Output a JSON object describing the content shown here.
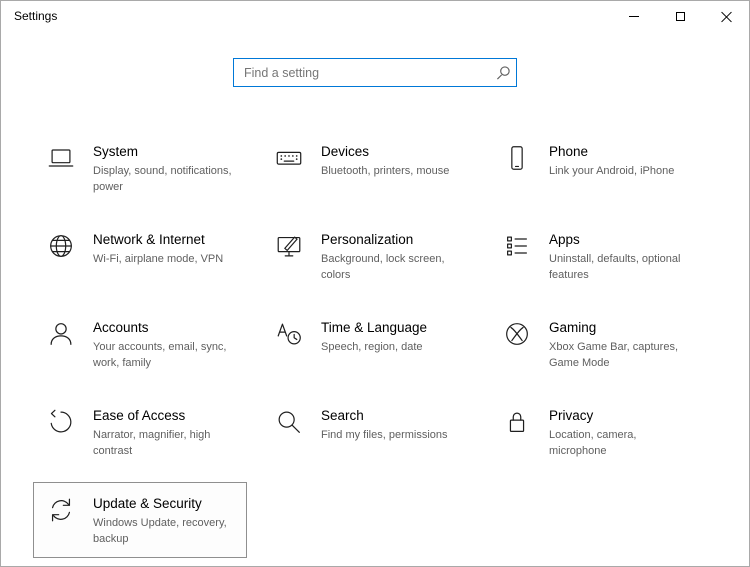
{
  "window": {
    "title": "Settings"
  },
  "search": {
    "placeholder": "Find a setting",
    "icon": "search-icon"
  },
  "accent_color": "#0078d7",
  "categories": [
    {
      "name": "system",
      "title": "System",
      "desc": "Display, sound, notifications, power",
      "icon": "laptop-icon",
      "highlighted": false
    },
    {
      "name": "devices",
      "title": "Devices",
      "desc": "Bluetooth, printers, mouse",
      "icon": "devices-icon",
      "highlighted": false
    },
    {
      "name": "phone",
      "title": "Phone",
      "desc": "Link your Android, iPhone",
      "icon": "phone-icon",
      "highlighted": false
    },
    {
      "name": "network-internet",
      "title": "Network & Internet",
      "desc": "Wi-Fi, airplane mode, VPN",
      "icon": "globe-icon",
      "highlighted": false
    },
    {
      "name": "personalization",
      "title": "Personalization",
      "desc": "Background, lock screen, colors",
      "icon": "personalization-icon",
      "highlighted": false
    },
    {
      "name": "apps",
      "title": "Apps",
      "desc": "Uninstall, defaults, optional features",
      "icon": "apps-list-icon",
      "highlighted": false
    },
    {
      "name": "accounts",
      "title": "Accounts",
      "desc": "Your accounts, email, sync, work, family",
      "icon": "person-icon",
      "highlighted": false
    },
    {
      "name": "time-language",
      "title": "Time & Language",
      "desc": "Speech, region, date",
      "icon": "time-language-icon",
      "highlighted": false
    },
    {
      "name": "gaming",
      "title": "Gaming",
      "desc": "Xbox Game Bar, captures, Game Mode",
      "icon": "xbox-icon",
      "highlighted": false
    },
    {
      "name": "ease-of-access",
      "title": "Ease of Access",
      "desc": "Narrator, magnifier, high contrast",
      "icon": "ease-of-access-icon",
      "highlighted": false
    },
    {
      "name": "search",
      "title": "Search",
      "desc": "Find my files, permissions",
      "icon": "search-icon",
      "highlighted": false
    },
    {
      "name": "privacy",
      "title": "Privacy",
      "desc": "Location, camera, microphone",
      "icon": "lock-icon",
      "highlighted": false
    },
    {
      "name": "update-security",
      "title": "Update & Security",
      "desc": "Windows Update, recovery, backup",
      "icon": "update-icon",
      "highlighted": true
    }
  ]
}
